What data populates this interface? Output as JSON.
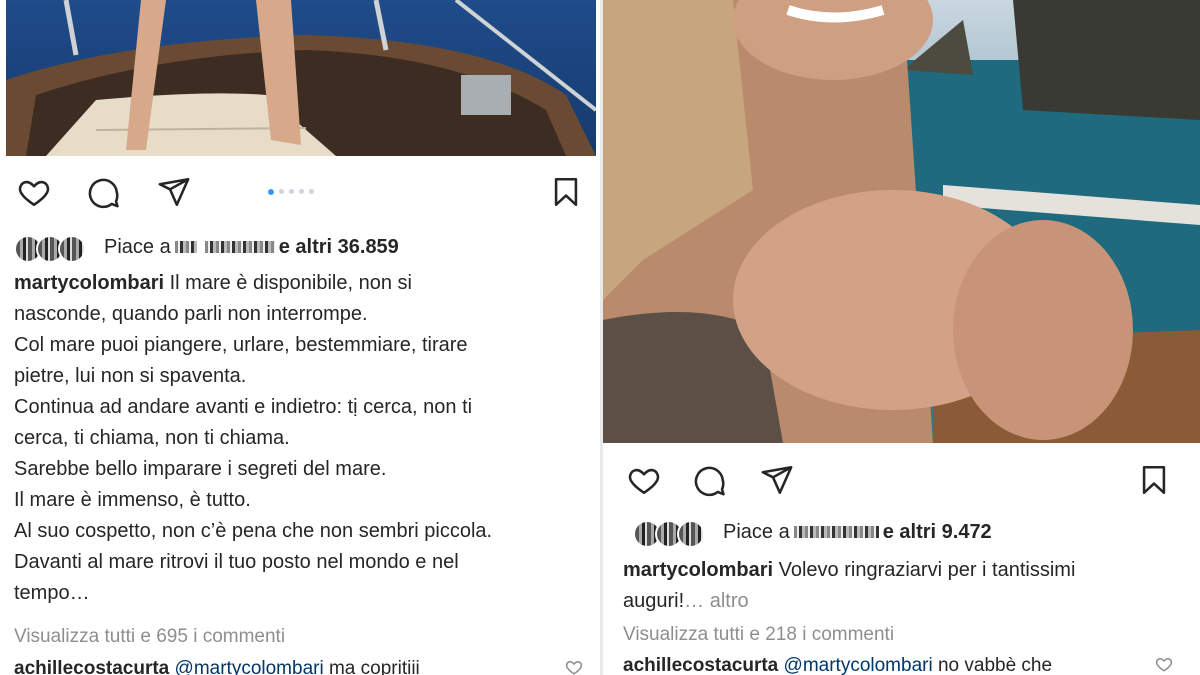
{
  "posts": [
    {
      "likes": {
        "prefix": "Piace a",
        "suffix": "e altri 36.859"
      },
      "username": "martycolombari",
      "caption_lines": [
        "Il mare è disponibile, non si",
        "nasconde, quando parli non interrompe.",
        "Col mare puoi piangere, urlare, bestemmiare, tirare",
        "pietre, lui non si spaventa.",
        "Continua ad andare avanti e indietro: tị cerca, non ti",
        "cerca, ti chiama, non ti chiama.",
        "Sarebbe bello imparare i segreti del mare.",
        "Il mare è immenso, è tutto.",
        "Al suo cospetto, non c’è pena che non sembri piccola.",
        "Davanti al mare ritrovi il tuo posto nel mondo e nel",
        "tempo…"
      ],
      "view_comments": "Visualizza tutti e 695 i commenti",
      "comment": {
        "user": "achillecostacurta",
        "mention": "@martycolombari",
        "text": "ma copritiii"
      },
      "carousel_total": 5,
      "carousel_active": 1
    },
    {
      "likes": {
        "prefix": "Piace a",
        "suffix": "e altri 9.472"
      },
      "username": "martycolombari",
      "caption_first": "Volevo ringraziarvi per i tantissimi",
      "caption_second": "auguri!",
      "more": "… altro",
      "view_comments": "Visualizza tutti e 218 i commenti",
      "comment": {
        "user": "achillecostacurta",
        "mention": "@martycolombari",
        "text": "no vabbè che"
      }
    }
  ],
  "icons": [
    "heart-icon",
    "comment-icon",
    "share-icon",
    "bookmark-icon"
  ],
  "colors": {
    "text": "#262626",
    "muted": "#8e8e8e",
    "accent": "#3897f0",
    "mention": "#00376b"
  }
}
